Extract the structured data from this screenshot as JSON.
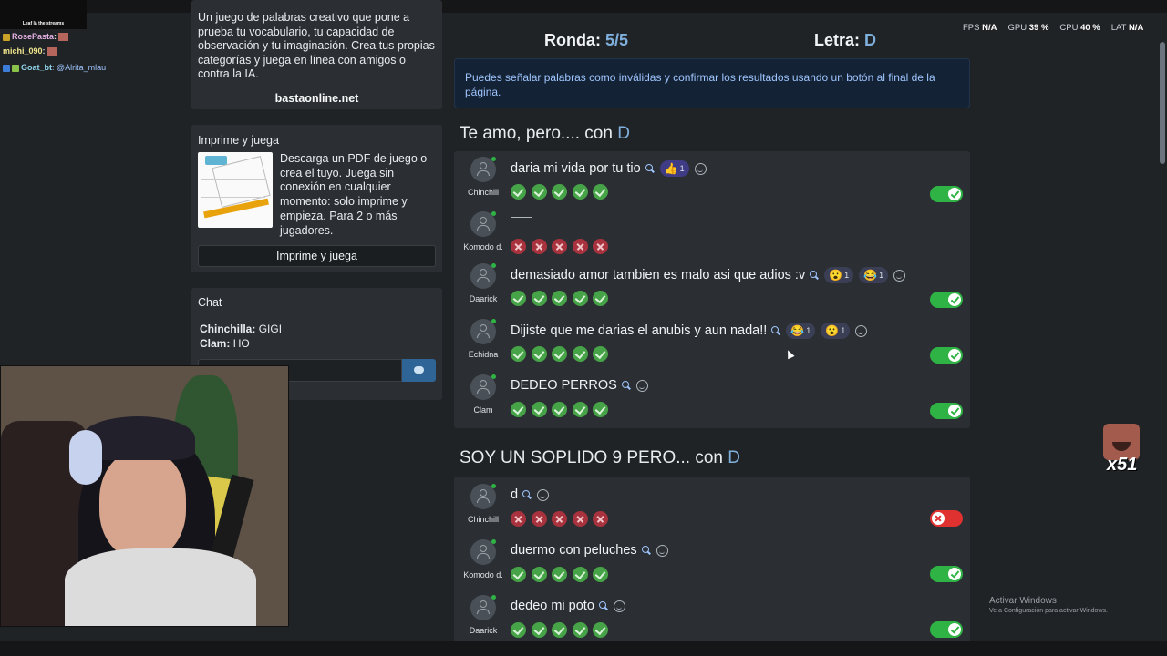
{
  "stream_overlay": {
    "banner": "Leaf là the streams",
    "chat": [
      {
        "user": "RosePasta",
        "text": ":",
        "color": "#e6b3e6"
      },
      {
        "user": "michi_090",
        "text": ":",
        "color": "#f0e68c"
      },
      {
        "user": "Goat_bt",
        "text": ": @Alrita_mlau",
        "color": "#8fd3e8"
      }
    ]
  },
  "intro": {
    "text": "Un juego de palabras creativo que pone a prueba tu vocabulario, tu capacidad de observación y tu imaginación. Crea tus propias categorías y juega en línea con amigos o contra la IA.",
    "link": "bastaonline.net"
  },
  "print_section": {
    "title": "Imprime y juega",
    "description": "Descarga un PDF de juego o crea el tuyo. Juega sin conexión en cualquier momento: solo imprime y empieza. Para 2 o más jugadores.",
    "button": "Imprime y juega"
  },
  "chat": {
    "title": "Chat",
    "messages": [
      {
        "user": "Chinchilla:",
        "text": "GIGI"
      },
      {
        "user": "Clam:",
        "text": "HO"
      }
    ],
    "input_placeholder": ""
  },
  "game": {
    "round_label": "Ronda:",
    "round_value": "5/5",
    "letter_label": "Letra:",
    "letter_value": "D",
    "info": "Puedes señalar palabras como inválidas y confirmar los resultados usando un botón al final de la página."
  },
  "sections": [
    {
      "heading": "Te amo, pero.... con",
      "letter": "D",
      "answers": [
        {
          "player": "Chinchill",
          "text": "daria mi vida por tu tio",
          "reactions": [
            {
              "emoji": "👍",
              "count": "1",
              "kind": "like"
            }
          ],
          "votes": [
            "ok",
            "ok",
            "ok",
            "ok",
            "ok"
          ],
          "valid": true
        },
        {
          "player": "Komodo d.",
          "text": "",
          "reactions": [],
          "votes": [
            "no",
            "no",
            "no",
            "no",
            "no"
          ],
          "valid": null
        },
        {
          "player": "Daarick",
          "text": "demasiado amor tambien es malo asi que adios :v",
          "reactions": [
            {
              "emoji": "😮",
              "count": "1",
              "kind": "emoji"
            },
            {
              "emoji": "😂",
              "count": "1",
              "kind": "emoji"
            }
          ],
          "votes": [
            "ok",
            "ok",
            "ok",
            "ok",
            "ok"
          ],
          "valid": true
        },
        {
          "player": "Echidna",
          "text": "Dijiste que me darias el anubis y aun nada!!",
          "reactions": [
            {
              "emoji": "😂",
              "count": "1",
              "kind": "emoji"
            },
            {
              "emoji": "😮",
              "count": "1",
              "kind": "emoji"
            }
          ],
          "votes": [
            "ok",
            "ok",
            "ok",
            "ok",
            "ok"
          ],
          "valid": true
        },
        {
          "player": "Clam",
          "text": "DEDEO PERROS",
          "reactions": [],
          "votes": [
            "ok",
            "ok",
            "ok",
            "ok",
            "ok"
          ],
          "valid": true
        }
      ]
    },
    {
      "heading": "SOY UN SOPLIDO 9 PERO... con",
      "letter": "D",
      "answers": [
        {
          "player": "Chinchill",
          "text": "d",
          "reactions": [],
          "votes": [
            "no",
            "no",
            "no",
            "no",
            "no"
          ],
          "valid": false
        },
        {
          "player": "Komodo d.",
          "text": "duermo con peluches",
          "reactions": [],
          "votes": [
            "ok",
            "ok",
            "ok",
            "ok",
            "ok"
          ],
          "valid": true
        },
        {
          "player": "Daarick",
          "text": "dedeo mi poto",
          "reactions": [],
          "votes": [
            "ok",
            "ok",
            "ok",
            "ok",
            "ok"
          ],
          "valid": true
        }
      ]
    }
  ],
  "perf_hud": [
    {
      "label": "FPS",
      "value": "N/A"
    },
    {
      "label": "GPU",
      "value": "39 %"
    },
    {
      "label": "CPU",
      "value": "40 %"
    },
    {
      "label": "LAT",
      "value": "N/A"
    }
  ],
  "emote_counter": "x51",
  "windows_activation": {
    "title": "Activar Windows",
    "subtitle": "Ve a Configuración para activar Windows."
  }
}
